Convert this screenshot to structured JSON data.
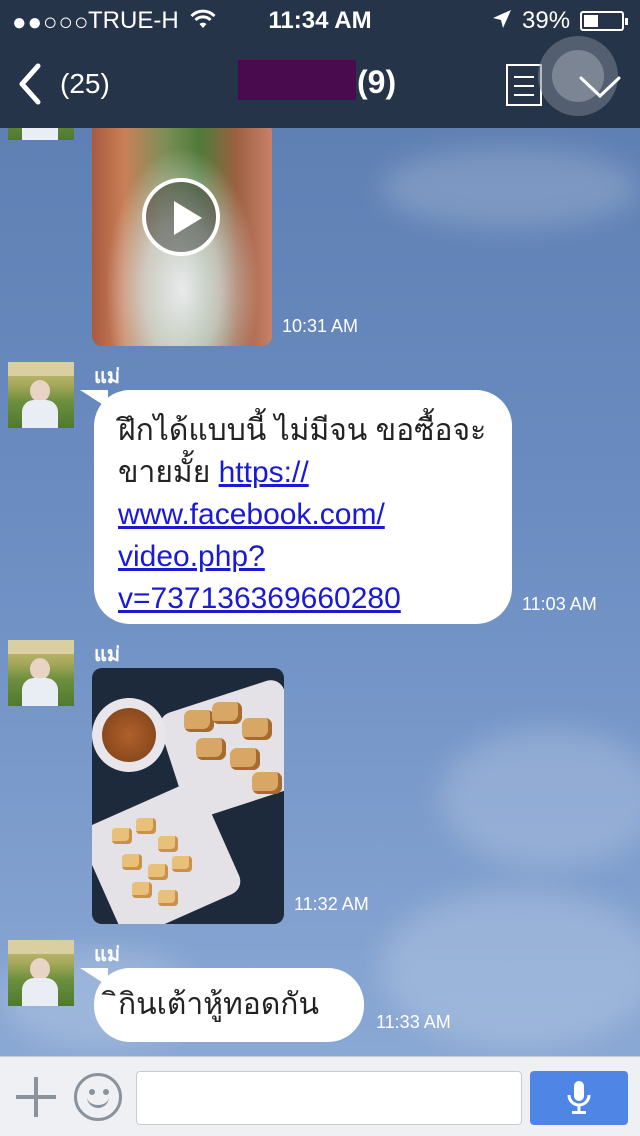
{
  "status_bar": {
    "signal": "●●○○○",
    "carrier": "TRUE-H",
    "time": "11:34 AM",
    "battery_percent": "39%",
    "battery_level": 0.39,
    "icons": [
      "wifi-icon",
      "location-arrow-icon",
      "battery-icon"
    ]
  },
  "nav": {
    "unread_count": "(25)",
    "member_count": "(9)",
    "icons": [
      "back-icon",
      "menu-icon",
      "chevron-down-icon"
    ]
  },
  "messages": [
    {
      "type": "video",
      "time": "10:31 AM"
    },
    {
      "type": "text",
      "sender": "แม่",
      "text_lines": [
        "ฝึกได้แบบนี้ ไม่มีจน ขอซื้อจะ",
        "ขายมั้ย "
      ],
      "link_lines": [
        "https://",
        "www.facebook.com/",
        "video.php?",
        "v=737136369660280"
      ],
      "time": "11:03 AM"
    },
    {
      "type": "photo",
      "sender": "แม่",
      "time": "11:32 AM"
    },
    {
      "type": "text",
      "sender": "แม่",
      "text": "ิกินเต้าหู้ทอดกัน",
      "time": "11:33 AM"
    }
  ],
  "input_bar": {
    "placeholder": "",
    "icons": [
      "plus-icon",
      "emoji-icon",
      "microphone-icon"
    ]
  },
  "colors": {
    "bar_bg": "#26344a",
    "chat_bg": "#6f8fbf",
    "link": "#1a1ad6",
    "mic_button": "#4f86e6"
  }
}
